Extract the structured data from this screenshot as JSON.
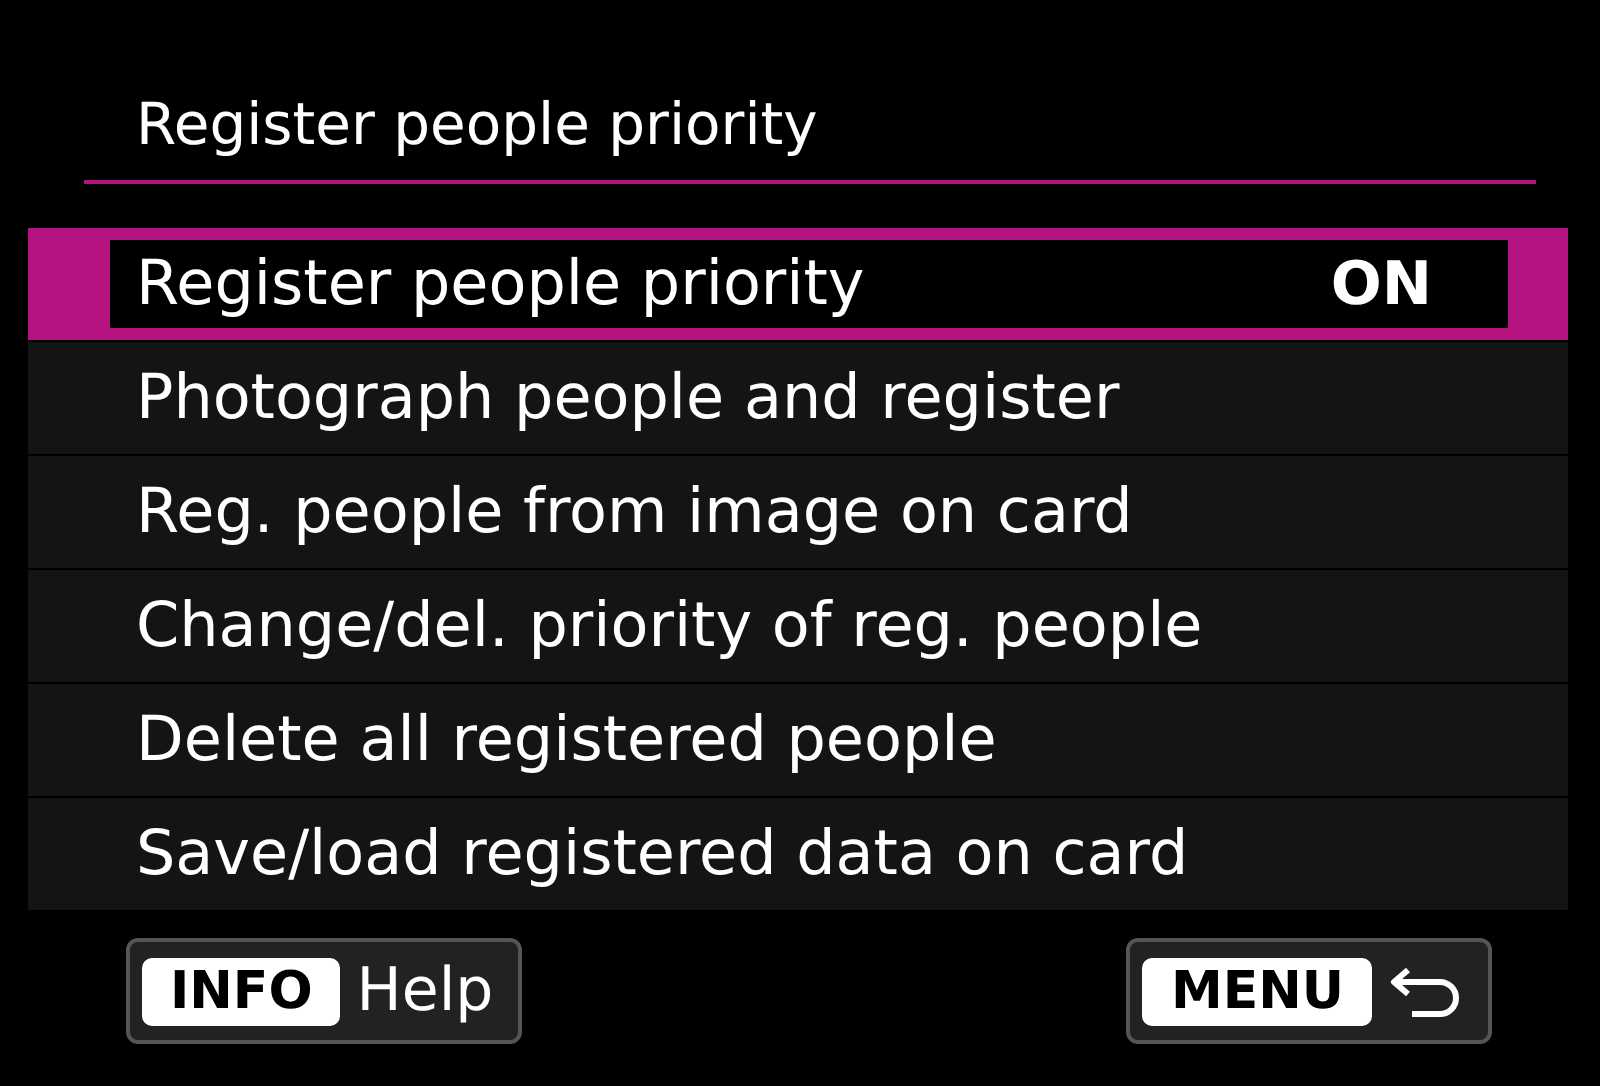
{
  "title": "Register people priority",
  "items": [
    {
      "label": "Register people priority",
      "value": "ON",
      "selected": true
    },
    {
      "label": "Photograph people and register",
      "selected": false
    },
    {
      "label": "Reg. people from image on card",
      "selected": false
    },
    {
      "label": "Change/del. priority of reg. people",
      "selected": false
    },
    {
      "label": "Delete all registered people",
      "selected": false
    },
    {
      "label": "Save/load registered data on card",
      "selected": false
    }
  ],
  "footer": {
    "help": {
      "key": "INFO",
      "label": "Help"
    },
    "back": {
      "key": "MENU"
    }
  }
}
